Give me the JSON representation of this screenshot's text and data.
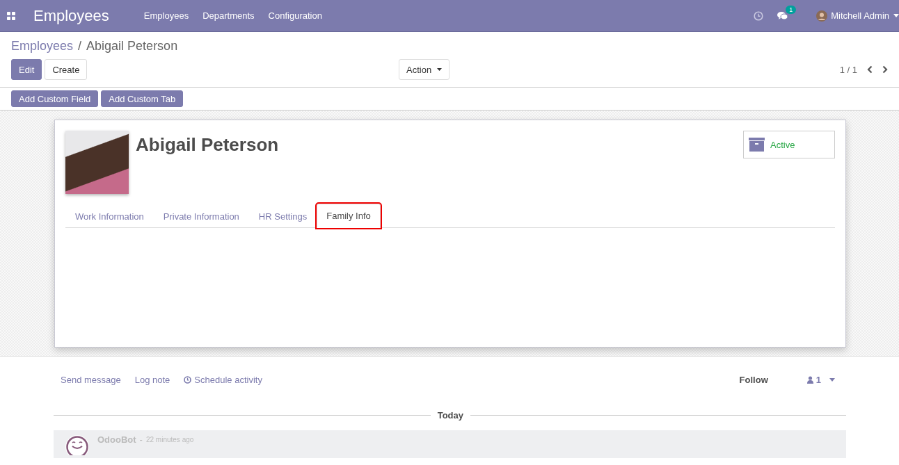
{
  "navbar": {
    "app_title": "Employees",
    "menu": [
      "Employees",
      "Departments",
      "Configuration"
    ],
    "message_count": "1",
    "user": "Mitchell Admin"
  },
  "breadcrumb": {
    "parent": "Employees",
    "separator": "/",
    "current": "Abigail Peterson"
  },
  "buttons": {
    "edit": "Edit",
    "create": "Create",
    "action": "Action"
  },
  "pager": "1 / 1",
  "studio_buttons": [
    "Add Custom Field",
    "Add Custom Tab"
  ],
  "employee": {
    "name": "Abigail Peterson",
    "status": "Active"
  },
  "tabs": [
    {
      "label": "Work Information",
      "selected": false,
      "highlighted": false
    },
    {
      "label": "Private Information",
      "selected": false,
      "highlighted": false
    },
    {
      "label": "HR Settings",
      "selected": false,
      "highlighted": false
    },
    {
      "label": "Family Info",
      "selected": true,
      "highlighted": true
    }
  ],
  "chatter": {
    "actions": [
      "Send message",
      "Log note",
      "Schedule activity"
    ],
    "follow": "Follow",
    "followers": "1",
    "date_separator": "Today",
    "message": {
      "author": "OdooBot",
      "separator": "-",
      "time": "22 minutes ago"
    }
  }
}
